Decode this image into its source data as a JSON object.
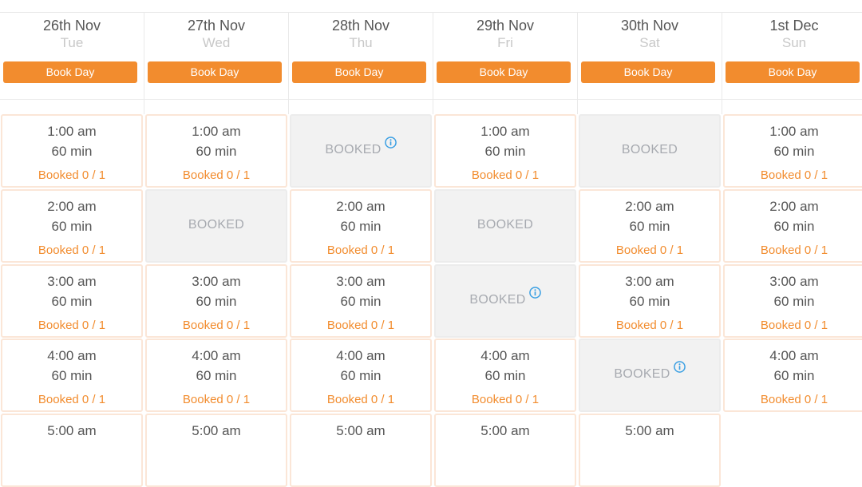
{
  "columns": [
    {
      "date": "26th Nov",
      "dow": "Tue",
      "book_label": "Book Day",
      "slots": [
        {
          "status": "open",
          "time": "1:00 am",
          "duration": "60 min",
          "capacity": "Booked 0 / 1"
        },
        {
          "status": "open",
          "time": "2:00 am",
          "duration": "60 min",
          "capacity": "Booked 0 / 1"
        },
        {
          "status": "open",
          "time": "3:00 am",
          "duration": "60 min",
          "capacity": "Booked 0 / 1"
        },
        {
          "status": "open",
          "time": "4:00 am",
          "duration": "60 min",
          "capacity": "Booked 0 / 1"
        },
        {
          "status": "open",
          "time": "5:00 am"
        }
      ]
    },
    {
      "date": "27th Nov",
      "dow": "Wed",
      "book_label": "Book Day",
      "slots": [
        {
          "status": "open",
          "time": "1:00 am",
          "duration": "60 min",
          "capacity": "Booked 0 / 1"
        },
        {
          "status": "booked",
          "label": "BOOKED",
          "info": false
        },
        {
          "status": "open",
          "time": "3:00 am",
          "duration": "60 min",
          "capacity": "Booked 0 / 1"
        },
        {
          "status": "open",
          "time": "4:00 am",
          "duration": "60 min",
          "capacity": "Booked 0 / 1"
        },
        {
          "status": "open",
          "time": "5:00 am"
        }
      ]
    },
    {
      "date": "28th Nov",
      "dow": "Thu",
      "book_label": "Book Day",
      "slots": [
        {
          "status": "booked",
          "label": "BOOKED",
          "info": true
        },
        {
          "status": "open",
          "time": "2:00 am",
          "duration": "60 min",
          "capacity": "Booked 0 / 1"
        },
        {
          "status": "open",
          "time": "3:00 am",
          "duration": "60 min",
          "capacity": "Booked 0 / 1"
        },
        {
          "status": "open",
          "time": "4:00 am",
          "duration": "60 min",
          "capacity": "Booked 0 / 1"
        },
        {
          "status": "open",
          "time": "5:00 am"
        }
      ]
    },
    {
      "date": "29th Nov",
      "dow": "Fri",
      "book_label": "Book Day",
      "slots": [
        {
          "status": "open",
          "time": "1:00 am",
          "duration": "60 min",
          "capacity": "Booked 0 / 1"
        },
        {
          "status": "booked",
          "label": "BOOKED",
          "info": false
        },
        {
          "status": "booked",
          "label": "BOOKED",
          "info": true
        },
        {
          "status": "open",
          "time": "4:00 am",
          "duration": "60 min",
          "capacity": "Booked 0 / 1"
        },
        {
          "status": "open",
          "time": "5:00 am"
        }
      ]
    },
    {
      "date": "30th Nov",
      "dow": "Sat",
      "book_label": "Book Day",
      "slots": [
        {
          "status": "booked",
          "label": "BOOKED",
          "info": false
        },
        {
          "status": "open",
          "time": "2:00 am",
          "duration": "60 min",
          "capacity": "Booked 0 / 1"
        },
        {
          "status": "open",
          "time": "3:00 am",
          "duration": "60 min",
          "capacity": "Booked 0 / 1"
        },
        {
          "status": "booked",
          "label": "BOOKED",
          "info": true
        },
        {
          "status": "open",
          "time": "5:00 am"
        }
      ]
    },
    {
      "date": "1st Dec",
      "dow": "Sun",
      "book_label": "Book Day",
      "slots": [
        {
          "status": "open",
          "time": "1:00 am",
          "duration": "60 min",
          "capacity": "Booked 0 / 1"
        },
        {
          "status": "open",
          "time": "2:00 am",
          "duration": "60 min",
          "capacity": "Booked 0 / 1"
        },
        {
          "status": "open",
          "time": "3:00 am",
          "duration": "60 min",
          "capacity": "Booked 0 / 1"
        },
        {
          "status": "open",
          "time": "4:00 am",
          "duration": "60 min",
          "capacity": "Booked 0 / 1"
        },
        {
          "status": "empty"
        }
      ]
    }
  ],
  "icons": {
    "info": "info-circle-icon"
  },
  "colors": {
    "accent": "#f28c2e",
    "info": "#3a9fe3",
    "booked_bg": "#f2f2f2",
    "slot_border": "#fbe6d7"
  }
}
